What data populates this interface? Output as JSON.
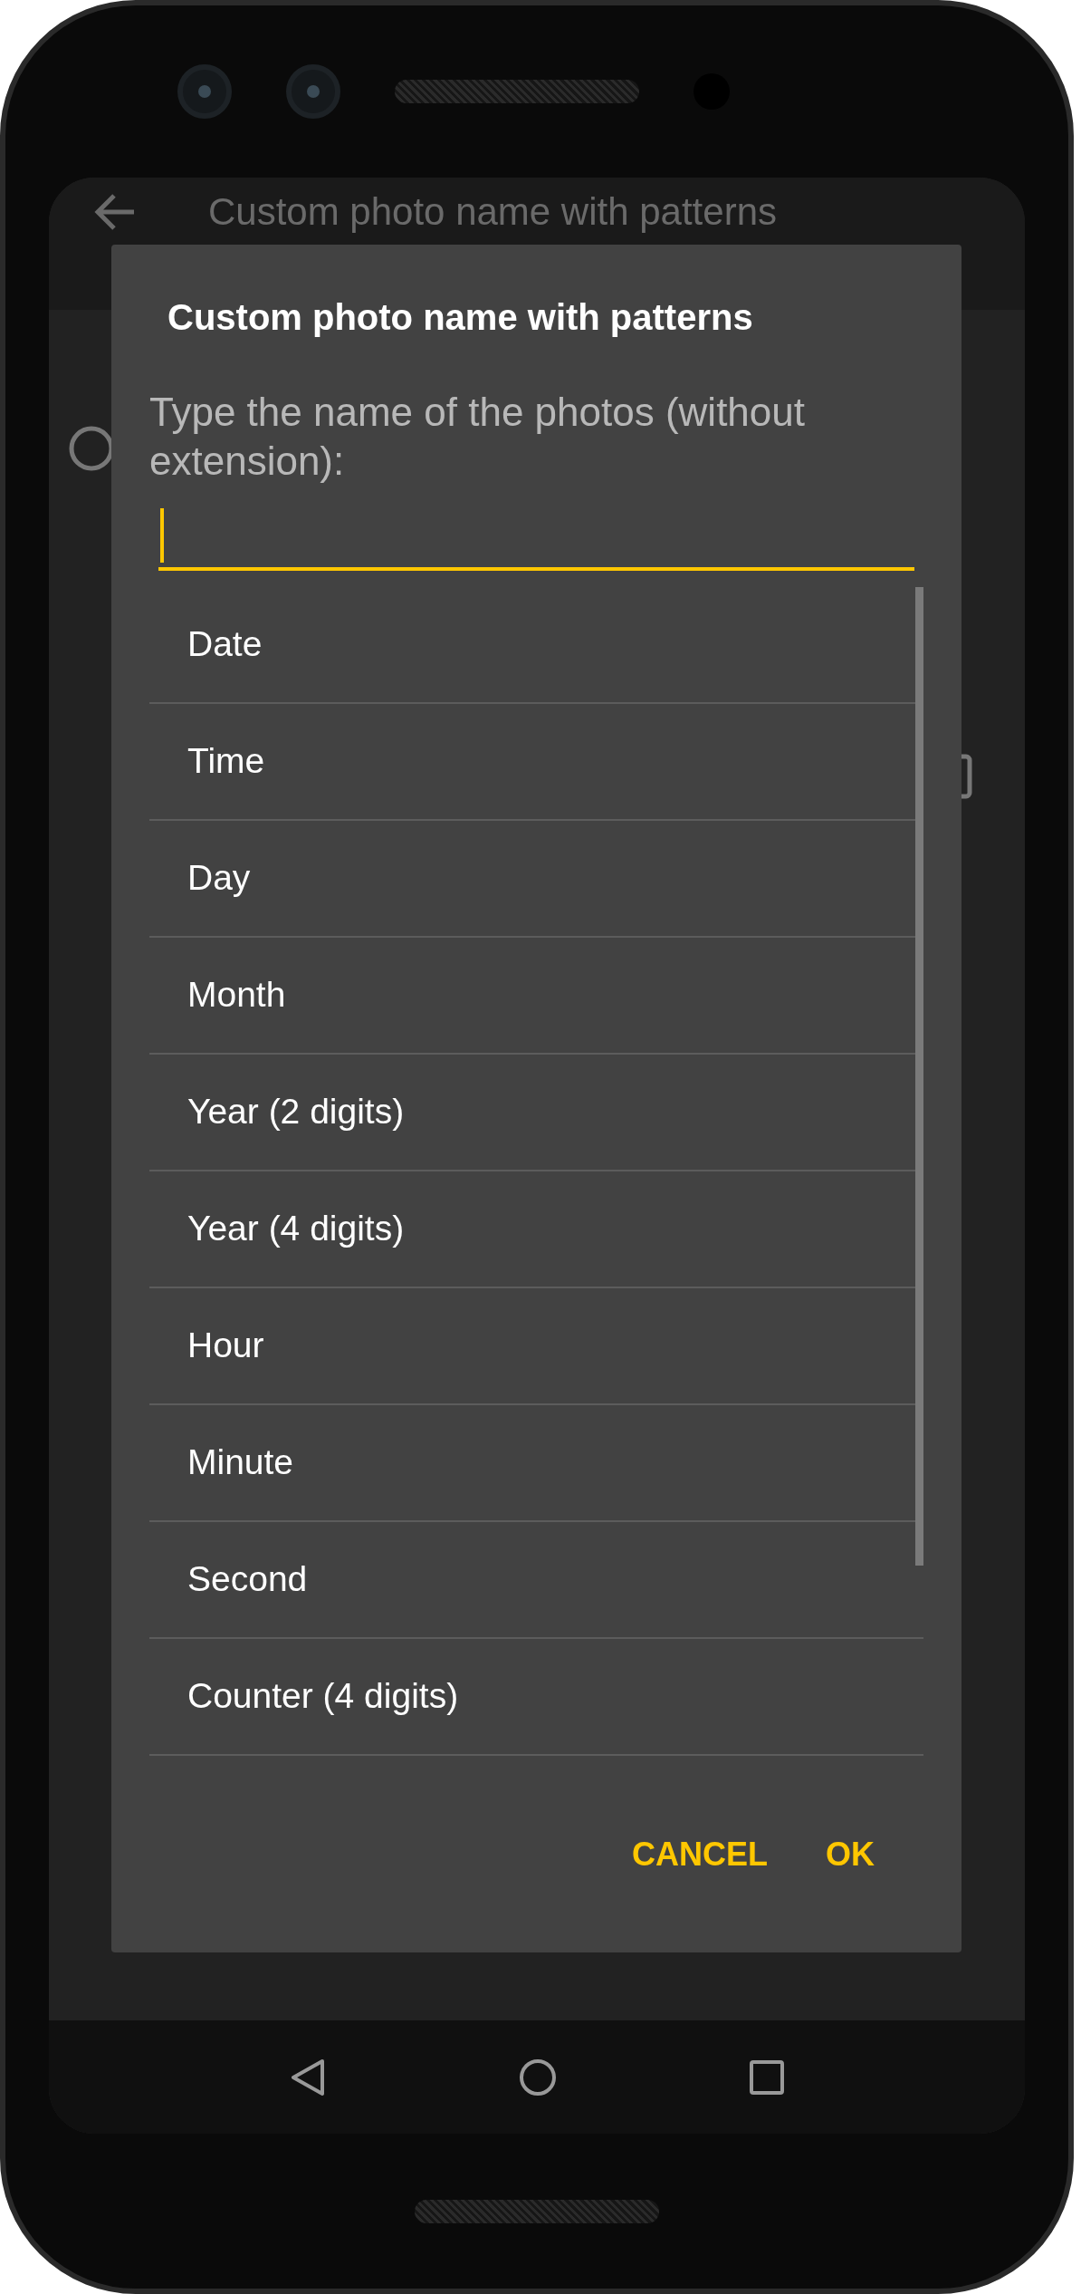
{
  "background": {
    "title": "Custom photo name with patterns"
  },
  "dialog": {
    "title": "Custom photo name with patterns",
    "message": "Type the name of the photos (without extension):",
    "input": {
      "focused": true
    },
    "patterns": [
      {
        "label": "Date"
      },
      {
        "label": "Time"
      },
      {
        "label": "Day"
      },
      {
        "label": "Month"
      },
      {
        "label": "Year (2 digits)"
      },
      {
        "label": "Year (4 digits)"
      },
      {
        "label": "Hour"
      },
      {
        "label": "Minute"
      },
      {
        "label": "Second"
      },
      {
        "label": "Counter (4 digits)"
      }
    ],
    "buttons": [
      {
        "label": "CANCEL"
      },
      {
        "label": "OK"
      }
    ]
  }
}
